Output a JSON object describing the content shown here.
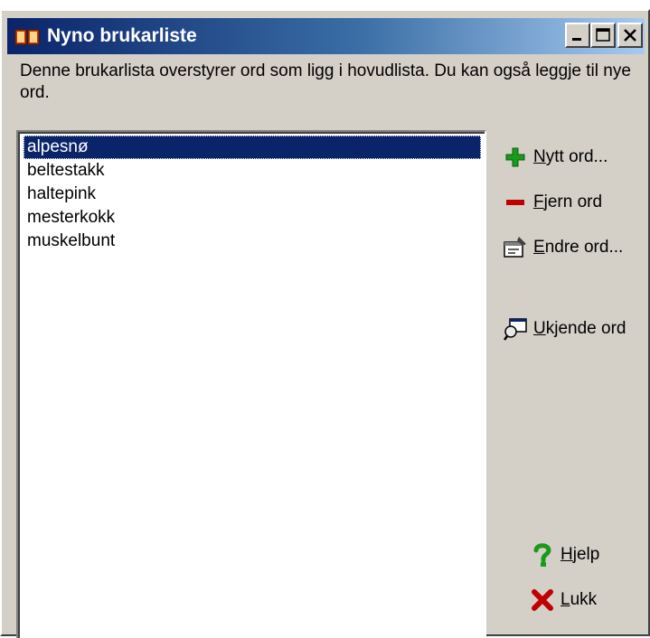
{
  "window": {
    "title": "Nyno brukarliste",
    "controls": {
      "minimize": "minimize",
      "maximize": "maximize",
      "close": "close"
    }
  },
  "description": "Denne brukarlista overstyrer ord som ligg i hovudlista. Du kan også leggje til nye ord.",
  "word_list": {
    "items": [
      "alpesnø",
      "beltestakk",
      "haltepink",
      "mesterkokk",
      "muskelbunt"
    ],
    "selected_index": 0
  },
  "actions": {
    "new_word": {
      "mnemonic": "N",
      "rest": "ytt ord...",
      "icon": "plus-icon",
      "color": "#1a9a1a"
    },
    "remove_word": {
      "mnemonic": "F",
      "rest": "jern ord",
      "icon": "minus-icon",
      "color": "#c00000"
    },
    "edit_word": {
      "mnemonic": "E",
      "rest": "ndre ord...",
      "icon": "edit-icon"
    },
    "unknown_words": {
      "mnemonic": "U",
      "rest": "kjende ord",
      "icon": "search-document-icon"
    },
    "help": {
      "mnemonic": "H",
      "rest": "jelp",
      "icon": "help-icon",
      "color": "#1a9a1a"
    },
    "close": {
      "mnemonic": "L",
      "rest": "ukk",
      "icon": "close-x-icon",
      "color": "#c00000"
    }
  }
}
